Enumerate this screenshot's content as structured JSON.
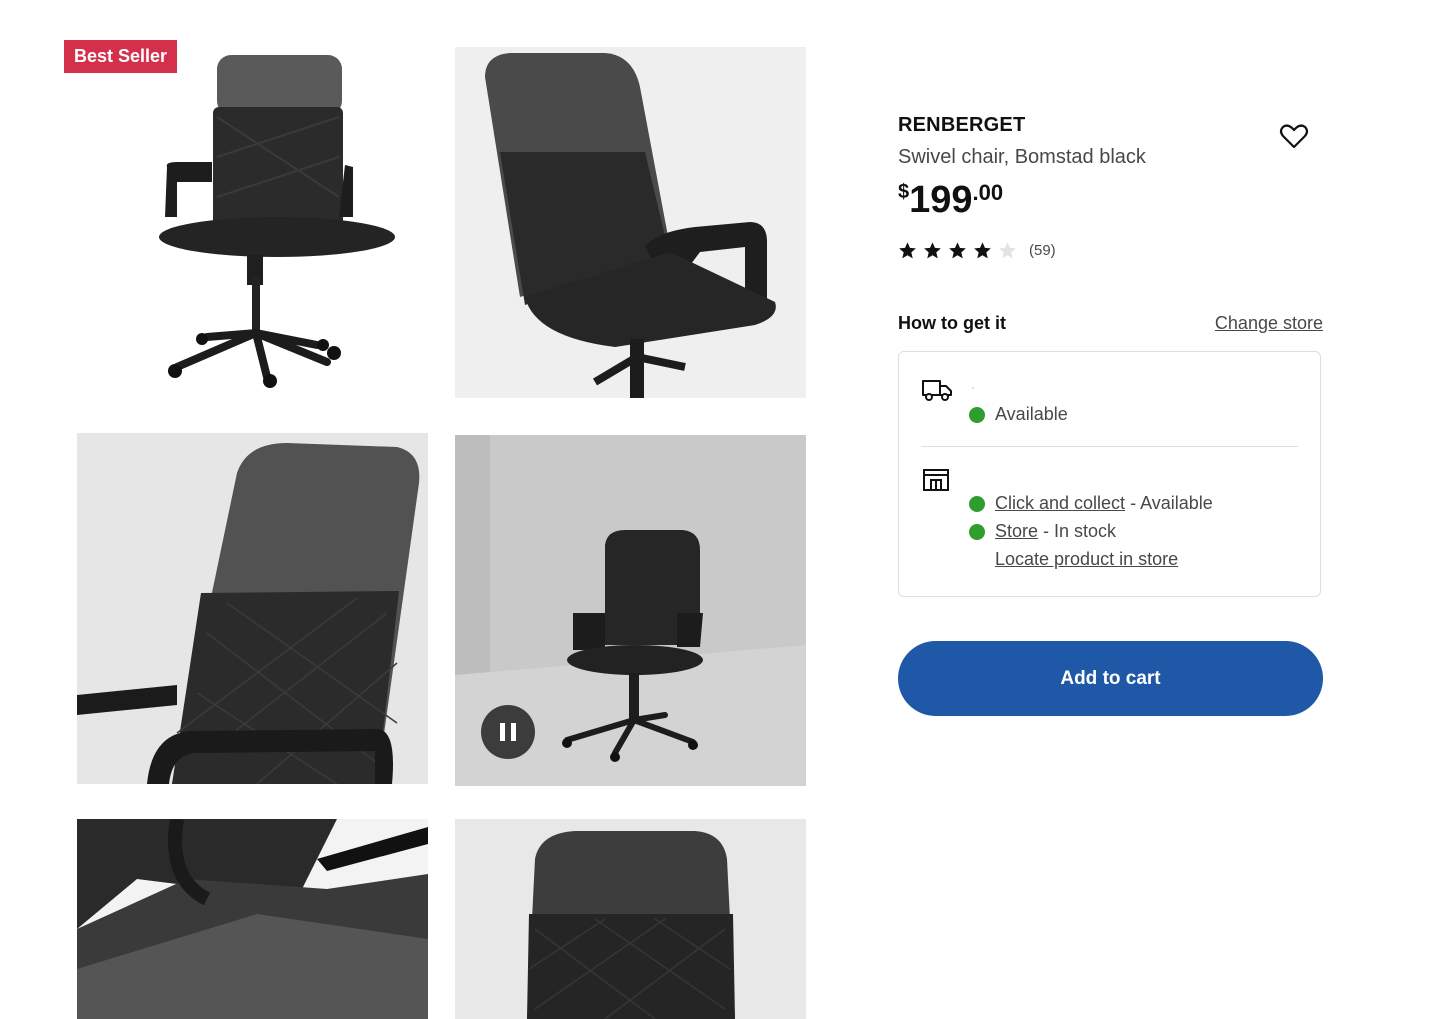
{
  "badge": {
    "label": "Best Seller",
    "color": "#d4304b"
  },
  "gallery": {
    "images": [
      {
        "name": "chair-front-view"
      },
      {
        "name": "chair-back-view"
      },
      {
        "name": "chair-backrest-closeup"
      },
      {
        "name": "chair-room-video"
      },
      {
        "name": "chair-seat-underside"
      },
      {
        "name": "chair-backrest-front"
      }
    ],
    "video_control_icon": "pause-icon"
  },
  "product": {
    "name": "RENBERGET",
    "description": "Swivel chair, Bomstad black",
    "price": {
      "currency": "$",
      "integer": "199",
      "decimal": ".00"
    },
    "favorite_icon": "heart-icon",
    "rating": {
      "value": 4,
      "max": 5,
      "count": "(59)"
    }
  },
  "availability": {
    "title": "How to get it",
    "change_store_label": "Change store",
    "delivery": {
      "icon": "truck-icon",
      "placeholder_text": "·",
      "status": "Available",
      "status_color": "#2e9e2e"
    },
    "store": {
      "icon": "store-icon",
      "click_collect_label": "Click and collect",
      "click_collect_status": " - Available",
      "store_label": "Store",
      "store_status": " - In stock",
      "locate_label": "Locate product in store"
    }
  },
  "cart": {
    "button_label": "Add to cart",
    "color": "#1e58a6"
  }
}
